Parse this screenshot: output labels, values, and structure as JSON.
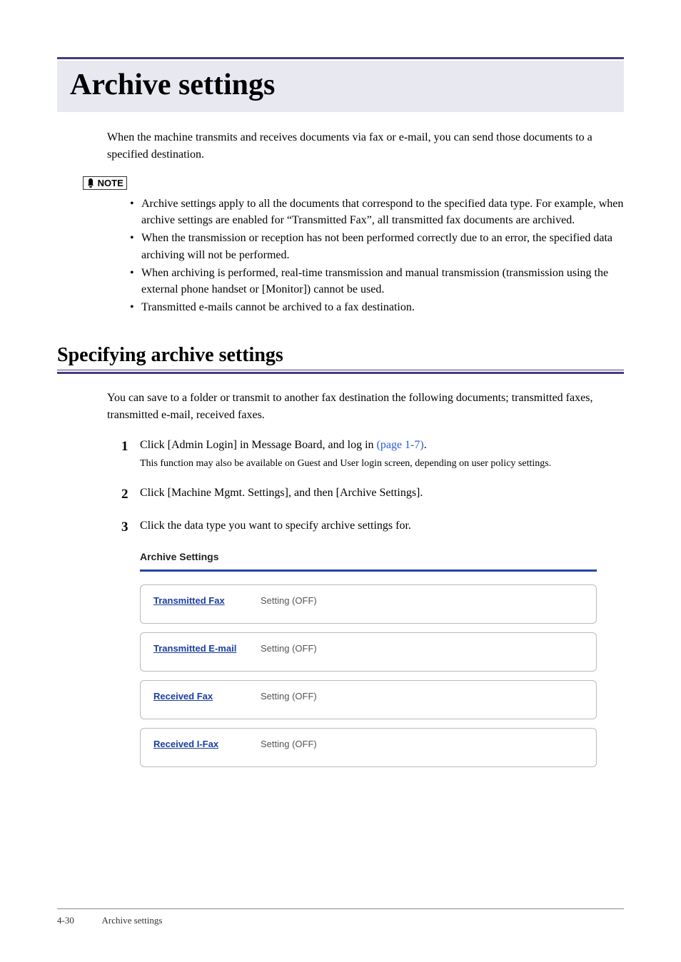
{
  "title": "Archive settings",
  "intro": "When the machine transmits and receives documents via fax or e-mail, you can send those documents to a specified destination.",
  "note_label": "NOTE",
  "notes": [
    "Archive settings apply to all the documents that correspond to the specified data type.  For example, when archive settings are enabled for “Transmitted Fax”, all transmitted fax documents are archived.",
    "When the transmission or reception has not been performed correctly due to an error, the specified data archiving will not be performed.",
    "When archiving is performed, real-time transmission and manual transmission (transmission using the external phone handset or [Monitor]) cannot be used.",
    "Transmitted e-mails cannot be archived to a fax destination."
  ],
  "h2": "Specifying archive settings",
  "sub_intro": "You can save to a folder or transmit to another fax destination the following documents; transmitted faxes, transmitted e-mail, received faxes.",
  "steps": [
    {
      "num": "1",
      "text_a": "Click [Admin Login] in Message Board, and log in ",
      "link": "(page 1-7)",
      "text_b": ".",
      "sub": "This function may also be available on Guest and User login screen, depending on user policy settings."
    },
    {
      "num": "2",
      "text_a": "Click [Machine Mgmt. Settings], and then [Archive Settings].",
      "link": "",
      "text_b": "",
      "sub": ""
    },
    {
      "num": "3",
      "text_a": "Click the data type you want to specify archive settings for.",
      "link": "",
      "text_b": "",
      "sub": ""
    }
  ],
  "screenshot": {
    "title": "Archive Settings",
    "rows": [
      {
        "label": "Transmitted Fax",
        "value": "Setting (OFF)"
      },
      {
        "label": "Transmitted E-mail",
        "value": "Setting (OFF)"
      },
      {
        "label": "Received Fax",
        "value": "Setting (OFF)"
      },
      {
        "label": "Received I-Fax",
        "value": "Setting (OFF)"
      }
    ]
  },
  "footer": {
    "page": "4-30",
    "running": "Archive settings"
  }
}
